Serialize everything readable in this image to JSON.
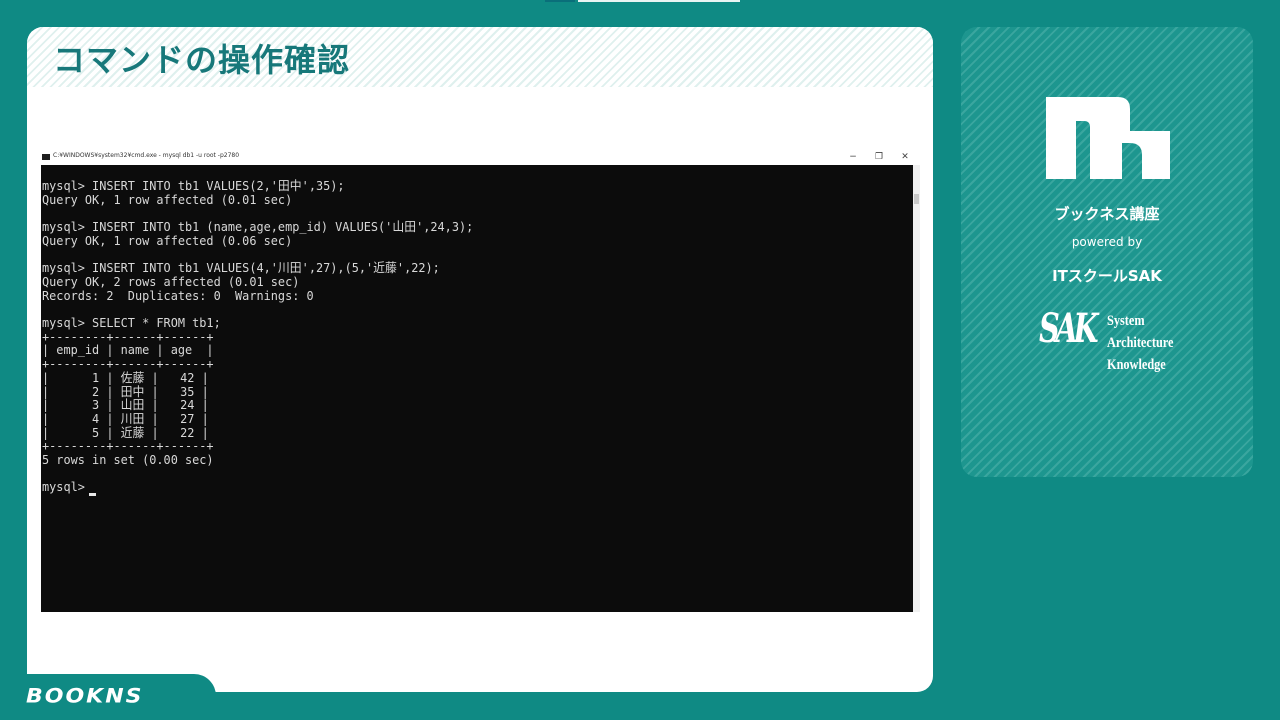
{
  "slide": {
    "title": "コマンドの操作確認"
  },
  "cmd_window": {
    "title": "C:¥WINDOWS¥system32¥cmd.exe - mysql  db1 -u root -p2780",
    "minimize_glyph": "−",
    "maximize_glyph": "❐",
    "close_glyph": "✕",
    "console_lines": [
      "mysql> INSERT INTO tb1 VALUES(2,'田中',35);",
      "Query OK, 1 row affected (0.01 sec)",
      "",
      "mysql> INSERT INTO tb1 (name,age,emp_id) VALUES('山田',24,3);",
      "Query OK, 1 row affected (0.06 sec)",
      "",
      "mysql> INSERT INTO tb1 VALUES(4,'川田',27),(5,'近藤',22);",
      "Query OK, 2 rows affected (0.01 sec)",
      "Records: 2  Duplicates: 0  Warnings: 0",
      "",
      "mysql> SELECT * FROM tb1;",
      "+--------+------+------+",
      "| emp_id | name | age  |",
      "+--------+------+------+",
      "|      1 | 佐藤 |   42 |",
      "|      2 | 田中 |   35 |",
      "|      3 | 山田 |   24 |",
      "|      4 | 川田 |   27 |",
      "|      5 | 近藤 |   22 |",
      "+--------+------+------+",
      "5 rows in set (0.00 sec)",
      "",
      "mysql> "
    ]
  },
  "side_panel": {
    "course_name": "ブックネス講座",
    "powered_by": "powered by",
    "school_name": "ITスクールSAK",
    "sak_letters": "SAK",
    "sak_lines": [
      "System",
      "Architecture",
      "Knowledge"
    ]
  },
  "footer": {
    "logo_text": "BOOKNS"
  }
}
